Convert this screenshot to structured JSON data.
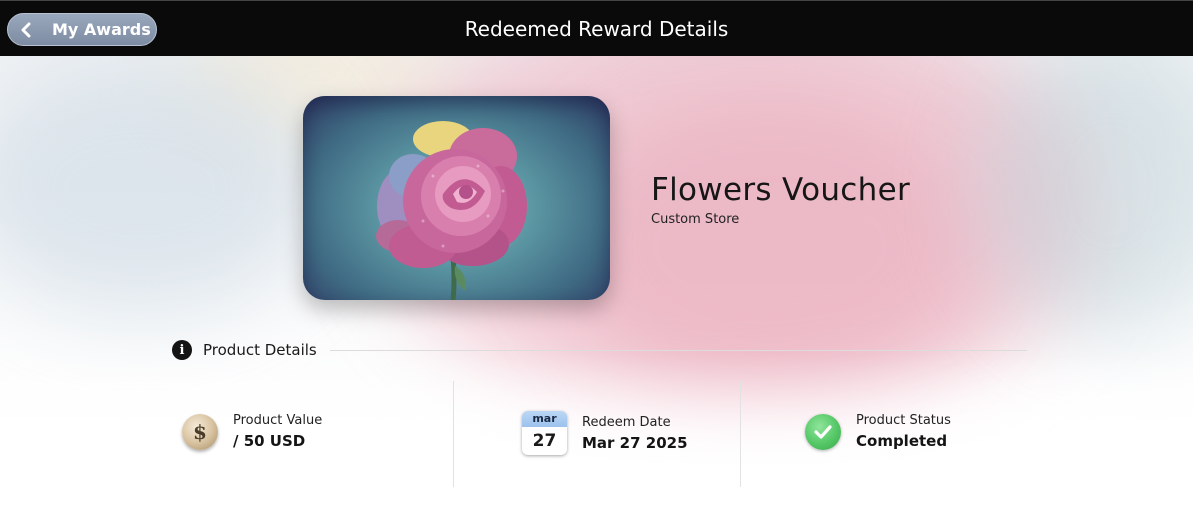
{
  "header": {
    "back_label": "My Awards",
    "title": "Redeemed Reward Details"
  },
  "product": {
    "title": "Flowers Voucher",
    "store": "Custom Store"
  },
  "section": {
    "label": "Product Details",
    "info_icon": "i"
  },
  "details": {
    "value": {
      "label": "Product Value",
      "value": "/ 50 USD",
      "icon_text": "$",
      "icon": "dollar-coin-icon"
    },
    "date": {
      "label": "Redeem Date",
      "value": "Mar 27 2025",
      "month": "mar",
      "day": "27",
      "icon": "calendar-icon"
    },
    "status": {
      "label": "Product Status",
      "value": "Completed",
      "icon": "check-circle-icon"
    }
  },
  "colors": {
    "header_bg": "#0b0a0a",
    "back_button": "#8796ad",
    "status_green": "#4cbf5d"
  }
}
